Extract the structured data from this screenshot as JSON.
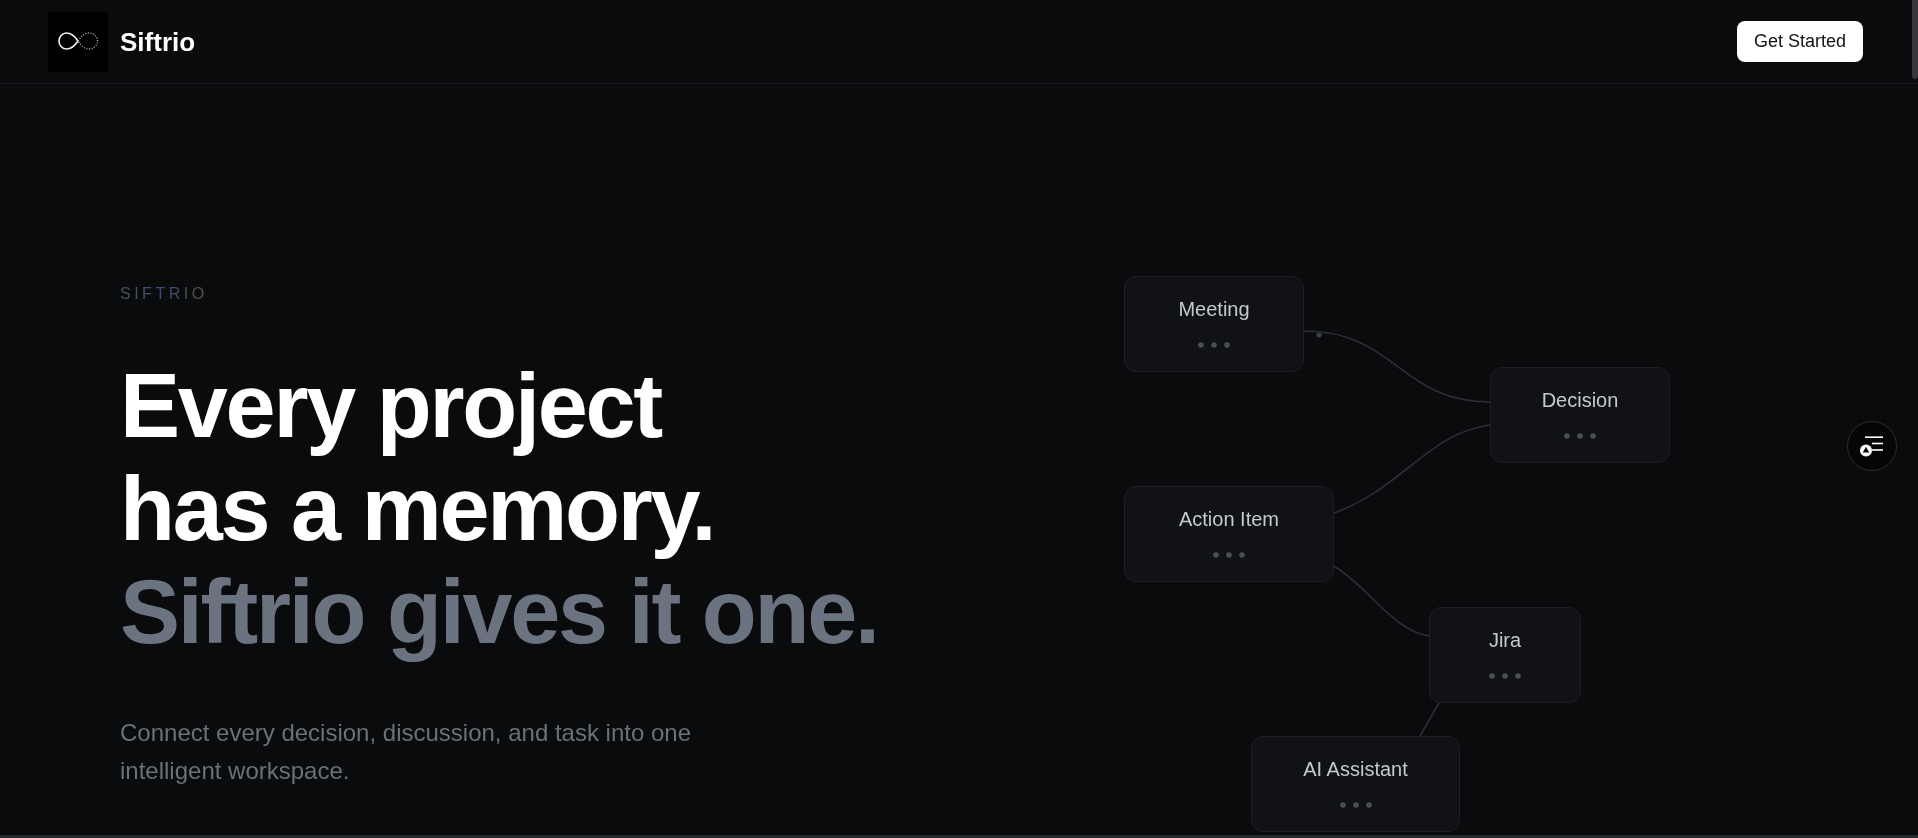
{
  "header": {
    "brand": "Siftrio",
    "cta": "Get Started"
  },
  "hero": {
    "eyebrow": "SIFTRIO",
    "headline": "Every project has a memory.",
    "tagline": "Siftrio gives it one.",
    "description": "Connect every decision, discussion, and task into one intelligent workspace."
  },
  "diagram": {
    "nodes": [
      {
        "label": "Meeting"
      },
      {
        "label": "Decision"
      },
      {
        "label": "Action Item"
      },
      {
        "label": "Jira"
      },
      {
        "label": "AI Assistant"
      }
    ]
  }
}
